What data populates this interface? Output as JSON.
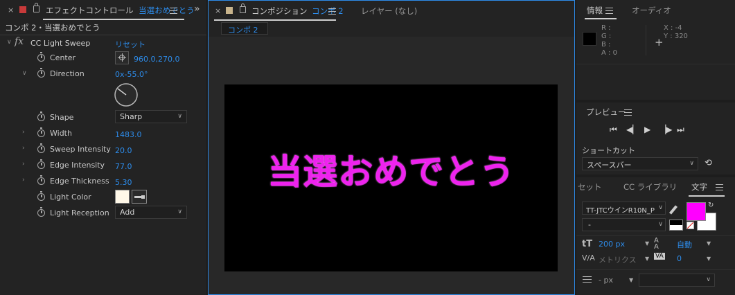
{
  "effect_panel": {
    "tab_title": "エフェクトコントロール",
    "tab_comp": "当選おめでとう",
    "breadcrumb": "コンポ 2・当選おめでとう",
    "effect_name": "CC Light Sweep",
    "reset_label": "リセット",
    "fx_label": "fx",
    "params": [
      {
        "label": "Center",
        "value": "960.0,270.0"
      },
      {
        "label": "Direction",
        "value": "0x-55.0°"
      },
      {
        "label": "Shape",
        "value": "Sharp"
      },
      {
        "label": "Width",
        "value": "1483.0"
      },
      {
        "label": "Sweep Intensity",
        "value": "20.0"
      },
      {
        "label": "Edge Intensity",
        "value": "77.0"
      },
      {
        "label": "Edge Thickness",
        "value": "5.30"
      },
      {
        "label": "Light Color",
        "value": ""
      },
      {
        "label": "Light Reception",
        "value": "Add"
      }
    ],
    "light_color": "#fff8e8",
    "direction_angle": -55
  },
  "comp_panel": {
    "tab_title": "コンポジション",
    "tab_comp": "コンポ 2",
    "layer_tab": "レイヤー (なし)",
    "sub_tab": "コンポ 2",
    "canvas_text": "当選おめでとう",
    "text_color": "#ee22ee"
  },
  "info_panel": {
    "tab_info": "情報",
    "tab_audio": "オーディオ",
    "r_label": "R :",
    "g_label": "G :",
    "b_label": "B :",
    "a_label": "A :  0",
    "x_label": "X : -4",
    "y_label": "Y : 320"
  },
  "preview_panel": {
    "title": "プレビュー",
    "shortcut_label": "ショートカット",
    "shortcut_value": "スペースバー"
  },
  "char_panel": {
    "tab_set": "セット",
    "tab_cc": "CC ライブラリ",
    "tab_char": "文字",
    "font_name": "TT-JTCウインR10N_P",
    "font_style": "-",
    "font_size": "200 px",
    "leading": "自動",
    "kerning": "メトリクス",
    "tracking": "0",
    "stroke_width": "- px",
    "fill_color": "#ff00ff"
  },
  "colors": {
    "accent_blue": "#2d8ceb",
    "panel_bg": "#232323",
    "comp_border": "#2d8ceb"
  }
}
